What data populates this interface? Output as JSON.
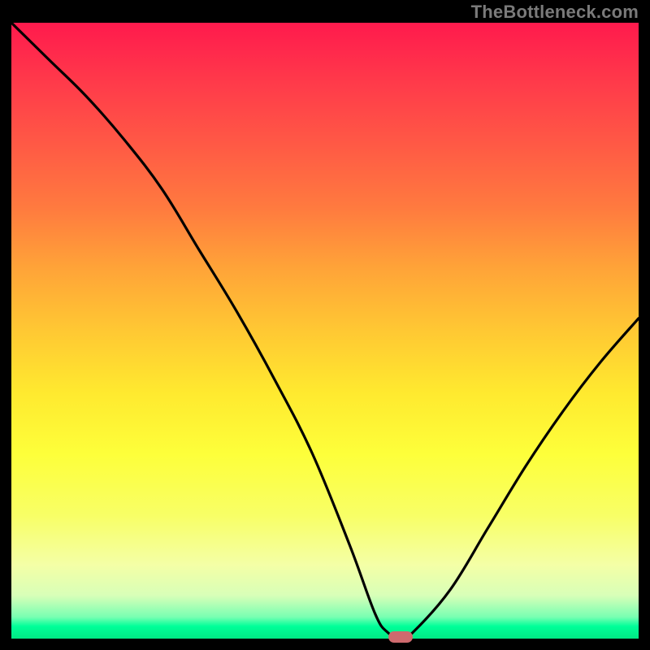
{
  "watermark": "TheBottleneck.com",
  "colors": {
    "frame": "#000000",
    "marker": "#cf6a6e",
    "curve": "#000000"
  },
  "chart_data": {
    "type": "line",
    "title": "",
    "xlabel": "",
    "ylabel": "",
    "xlim": [
      0,
      100
    ],
    "ylim": [
      0,
      100
    ],
    "grid": false,
    "series": [
      {
        "name": "bottleneck-curve",
        "x": [
          0,
          6,
          12,
          18,
          24,
          30,
          36,
          42,
          48,
          54,
          58,
          60,
          62,
          64,
          70,
          76,
          82,
          88,
          94,
          100
        ],
        "values": [
          100,
          94,
          88,
          81,
          73,
          63,
          53,
          42,
          30,
          15,
          4,
          1,
          0,
          1,
          8,
          18,
          28,
          37,
          45,
          52
        ]
      }
    ],
    "marker": {
      "x": 62,
      "y": 0
    },
    "background_gradient": {
      "stops": [
        {
          "pos": 0.0,
          "color": "#ff1a4d"
        },
        {
          "pos": 0.5,
          "color": "#ffc833"
        },
        {
          "pos": 0.88,
          "color": "#f4ffa6"
        },
        {
          "pos": 0.97,
          "color": "#78ffb2"
        },
        {
          "pos": 1.0,
          "color": "#00e884"
        }
      ]
    }
  }
}
